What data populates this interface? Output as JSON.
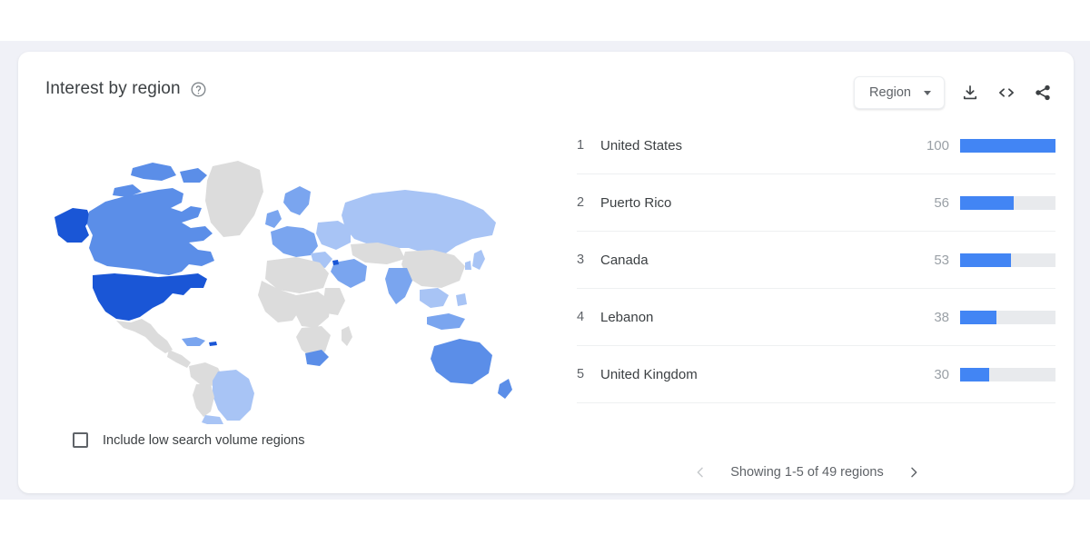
{
  "header": {
    "title": "Interest by region",
    "help_icon": "help-circle-icon",
    "region_select": {
      "label": "Region",
      "caret_icon": "chevron-down-icon"
    },
    "actions": [
      {
        "name": "download",
        "icon": "download-icon"
      },
      {
        "name": "embed",
        "icon": "embed-code-icon",
        "glyph": "<>"
      },
      {
        "name": "share",
        "icon": "share-icon"
      }
    ]
  },
  "map": {
    "include_low_volume": {
      "label": "Include low search volume regions",
      "checked": false
    },
    "colors": {
      "highest": "#1a56d6",
      "high": "#4d83e8",
      "medium": "#7aa5ef",
      "low": "#a8c4f5",
      "lowest": "#c6d8fa",
      "nodata": "#dcdcdc"
    }
  },
  "chart_data": {
    "type": "bar",
    "title": "Interest by region",
    "xlabel": "",
    "ylabel": "",
    "ylim": [
      0,
      100
    ],
    "categories": [
      "United States",
      "Puerto Rico",
      "Canada",
      "Lebanon",
      "United Kingdom"
    ],
    "values": [
      100,
      56,
      53,
      38,
      30
    ],
    "ranks": [
      1,
      2,
      3,
      4,
      5
    ],
    "bar_color": "#4285f4",
    "track_color": "#e8eaed",
    "rows": [
      {
        "rank": "1",
        "name": "United States",
        "value": "100",
        "pct": 100
      },
      {
        "rank": "2",
        "name": "Puerto Rico",
        "value": "56",
        "pct": 56
      },
      {
        "rank": "3",
        "name": "Canada",
        "value": "53",
        "pct": 53
      },
      {
        "rank": "4",
        "name": "Lebanon",
        "value": "38",
        "pct": 38
      },
      {
        "rank": "5",
        "name": "United Kingdom",
        "value": "30",
        "pct": 30
      }
    ]
  },
  "pagination": {
    "status": "Showing 1-5 of 49 regions",
    "prev_icon": "chevron-left-icon",
    "next_icon": "chevron-right-icon"
  }
}
